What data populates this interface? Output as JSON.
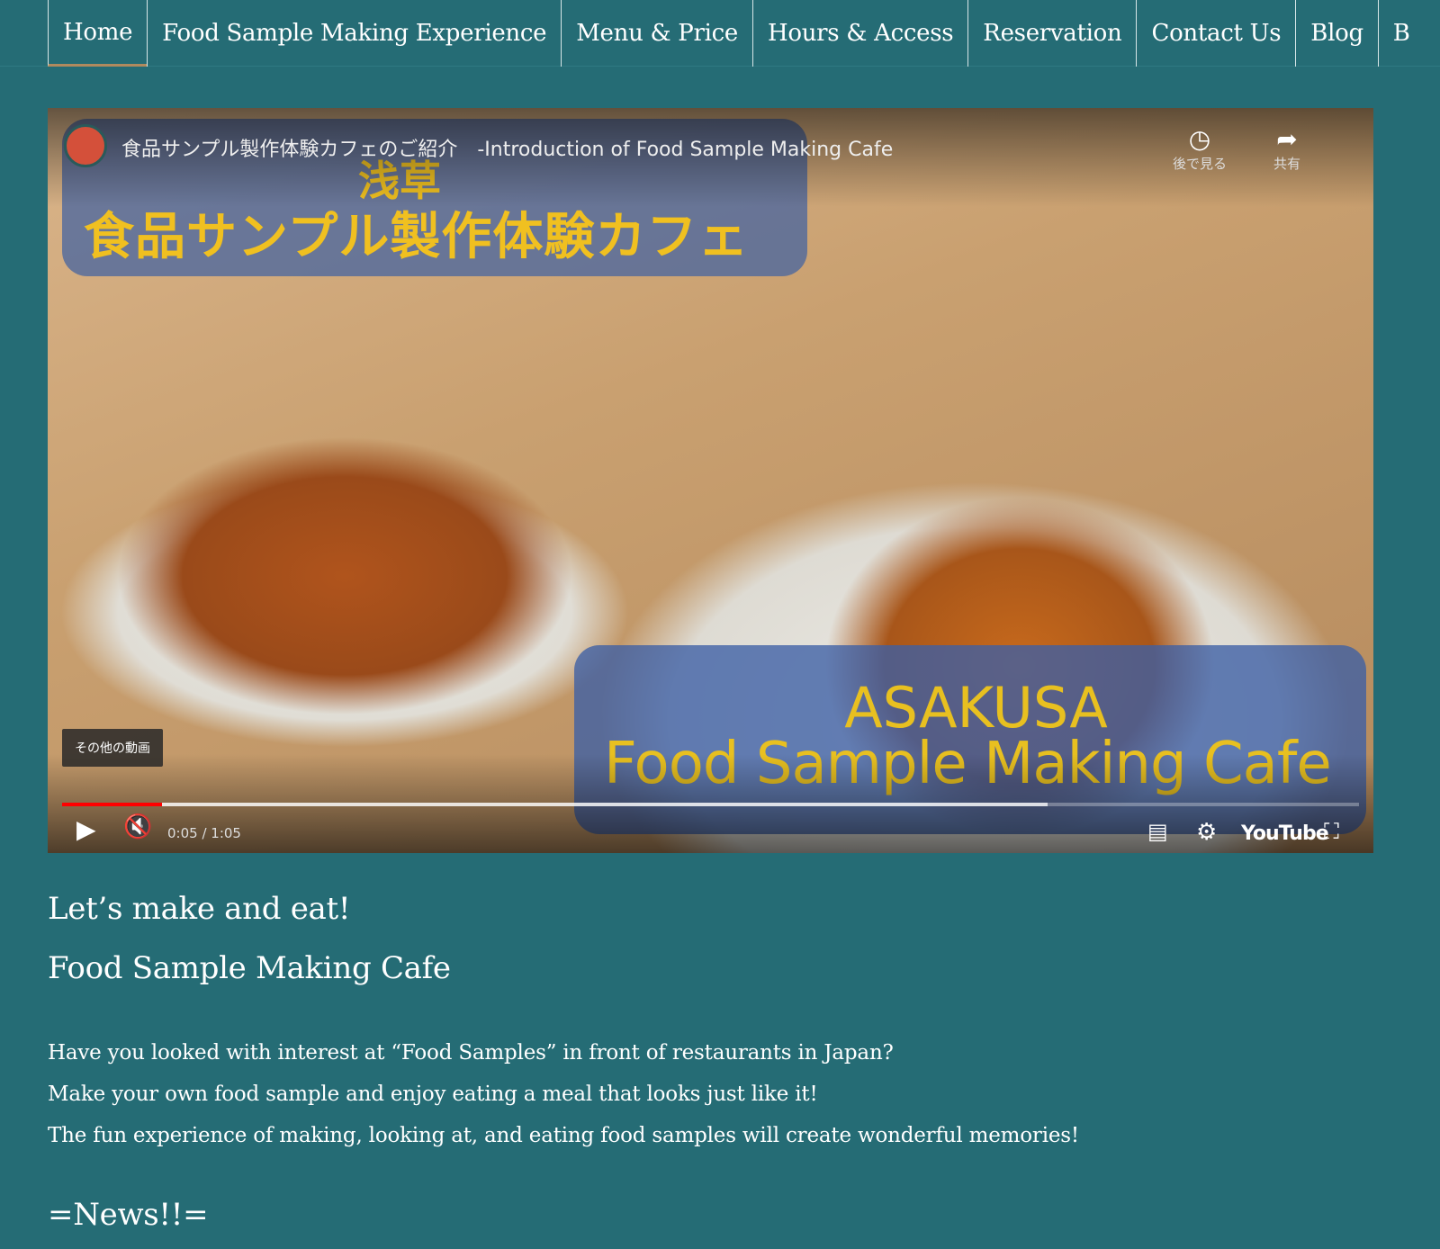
{
  "nav": {
    "items": [
      {
        "label": "Home",
        "active": true
      },
      {
        "label": "Food Sample Making Experience"
      },
      {
        "label": "Menu & Price"
      },
      {
        "label": "Hours & Access"
      },
      {
        "label": "Reservation"
      },
      {
        "label": "Contact Us"
      },
      {
        "label": "Blog"
      },
      {
        "label": "B"
      }
    ]
  },
  "video": {
    "title": "食品サンプル製作体験カフェのご紹介　-Introduction of Food Sample Making Cafe",
    "watch_later": "後で見る",
    "share": "共有",
    "overlay_jp_1": "浅草",
    "overlay_jp_2": "食品サンプル製作体験カフェ",
    "overlay_en_1": "ASAKUSA",
    "overlay_en_2": "Food Sample Making Cafe",
    "more_videos": "その他の動画",
    "time": "0:05 / 1:05",
    "progress_fraction": 0.077,
    "youtube_label": "YouTube"
  },
  "main": {
    "heading1": "Let’s make and eat!",
    "heading2": "Food Sample Making Cafe",
    "paragraphs": [
      "Have you looked with interest at “Food Samples” in front of restaurants in Japan?",
      "Make your own food sample and enjoy eating a meal that looks just like it!",
      "The fun experience of making, looking at, and eating food samples will create wonderful memories!"
    ],
    "news": "=News!!="
  },
  "colors": {
    "background": "#256c75",
    "overlay_text": "#f0c020",
    "progress": "#ff0000"
  }
}
